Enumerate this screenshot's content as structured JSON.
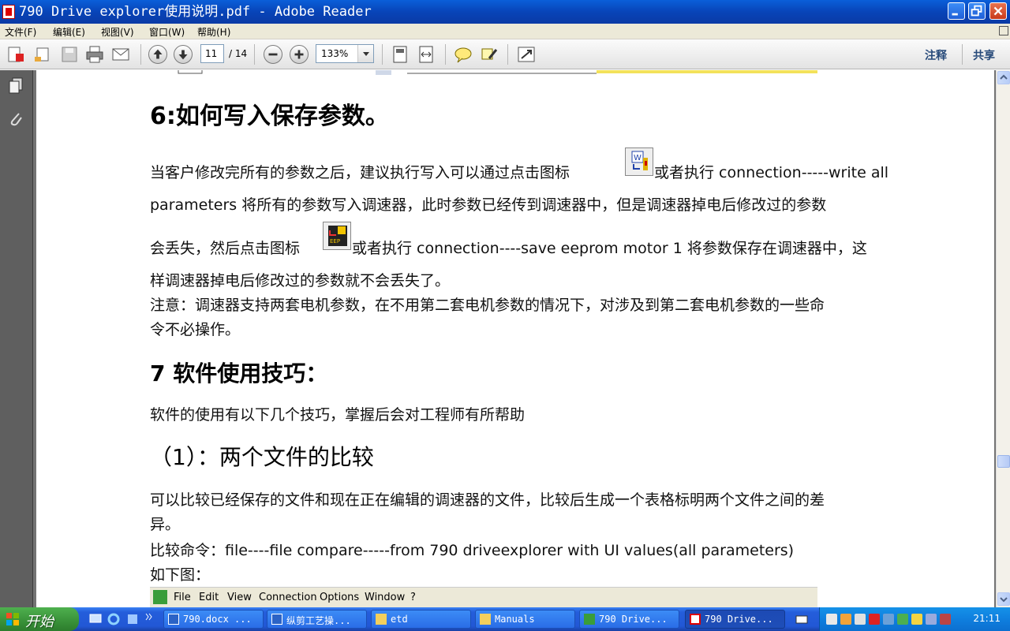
{
  "window": {
    "title": "790 Drive explorer使用说明.pdf - Adobe Reader"
  },
  "menubar": {
    "items": [
      "文件(F)",
      "编辑(E)",
      "视图(V)",
      "窗口(W)",
      "帮助(H)"
    ]
  },
  "toolbar": {
    "page_current": "11",
    "page_total": "/ 14",
    "zoom": "133%",
    "annotate_label": "注释",
    "share_label": "共享"
  },
  "document": {
    "heading6": "6:如何写入保存参数。",
    "p1_line1_a": "当客户修改完所有的参数之后，建议执行写入可以通过点击图标",
    "p1_line1_b": "或者执行  connection-----write  all",
    "p1_line2": "parameters  将所有的参数写入调速器，此时参数已经传到调速器中，但是调速器掉电后修改过的参数",
    "p1_line3_a": "会丢失，然后点击图标",
    "p1_line3_b": "或者执行 connection----save eeprom motor 1  将参数保存在调速器中，这",
    "p1_line4": "样调速器掉电后修改过的参数就不会丢失了。",
    "note_line1": "注意：调速器支持两套电机参数，在不用第二套电机参数的情况下，对涉及到第二套电机参数的一些命",
    "note_line2": "令不必操作。",
    "heading7": "7 软件使用技巧：",
    "p2": "软件的使用有以下几个技巧，掌握后会对工程师有所帮助",
    "subheading1": "（1）：两个文件的比较",
    "p3_line1": "可以比较已经保存的文件和现在正在编辑的调速器的文件，比较后生成一个表格标明两个文件之间的差",
    "p3_line2": "异。",
    "p4": "比较命令：file----file compare-----from 790 driveexplorer with UI values(all parameters)",
    "p5": "如下图：",
    "icon_write_label": "W",
    "icon_eeprom_label": "EEP",
    "embedded_menu": [
      "File",
      "Edit",
      "View",
      "Connection",
      "Options",
      "Window",
      "?"
    ]
  },
  "taskbar": {
    "start_label": "开始",
    "tasks": [
      {
        "label": "790.docx ..."
      },
      {
        "label": "纵剪工艺操..."
      },
      {
        "label": "etd"
      },
      {
        "label": "Manuals"
      },
      {
        "label": "790 Drive..."
      },
      {
        "label": "790 Drive..."
      }
    ],
    "clock": "21:11"
  }
}
